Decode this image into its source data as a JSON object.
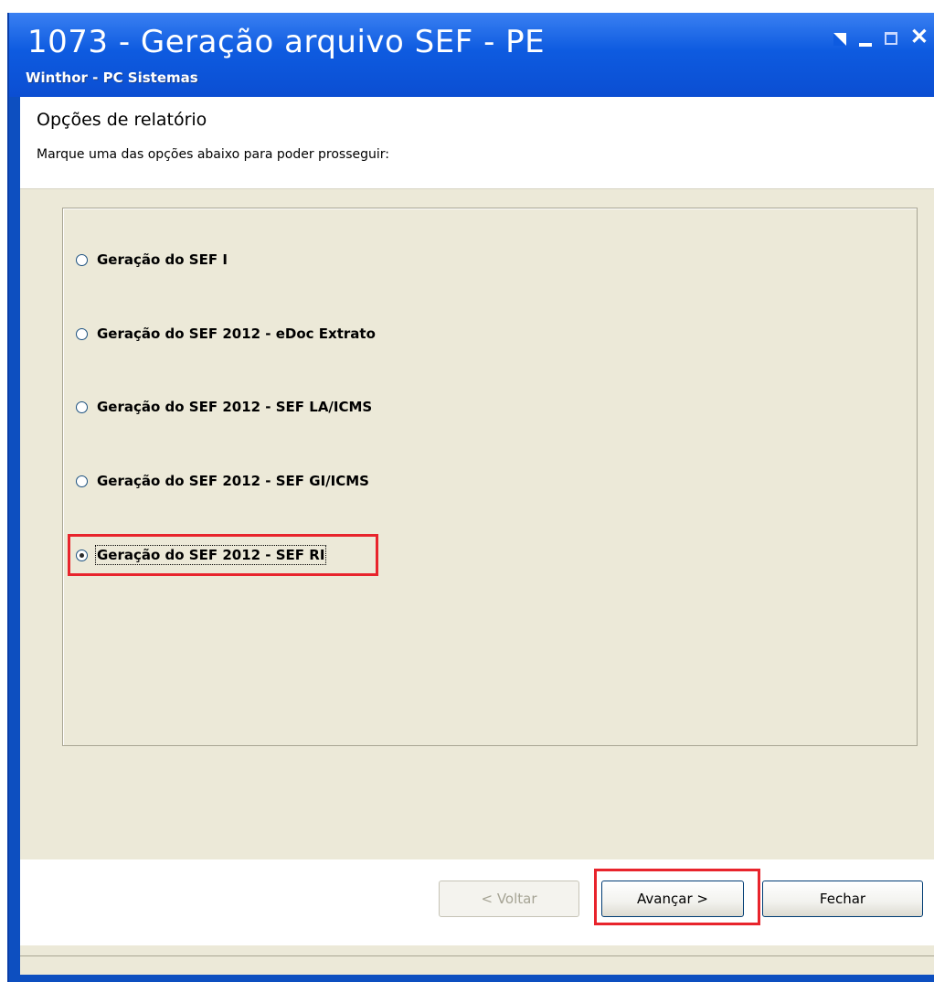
{
  "window": {
    "title": "1073 - Geração arquivo SEF - PE",
    "subtitle": "Winthor - PC Sistemas",
    "controls": {
      "minimize": "_",
      "close": "✕"
    }
  },
  "header": {
    "title": "Opções de relatório",
    "description": "Marque uma das opções abaixo para poder prosseguir:"
  },
  "options": [
    {
      "label": "Geração do SEF I",
      "selected": false
    },
    {
      "label": "Geração do SEF 2012 - eDoc Extrato",
      "selected": false
    },
    {
      "label": "Geração do SEF 2012 - SEF LA/ICMS",
      "selected": false
    },
    {
      "label": "Geração do SEF 2012 - SEF GI/ICMS",
      "selected": false
    },
    {
      "label": "Geração do SEF 2012 - SEF RI",
      "selected": true
    }
  ],
  "footer": {
    "back_label": "< Voltar",
    "next_label": "Avançar >",
    "close_label": "Fechar"
  },
  "colors": {
    "titlebar": "#0e5be0",
    "highlight": "#e8242c",
    "panel": "#ece9d8"
  }
}
